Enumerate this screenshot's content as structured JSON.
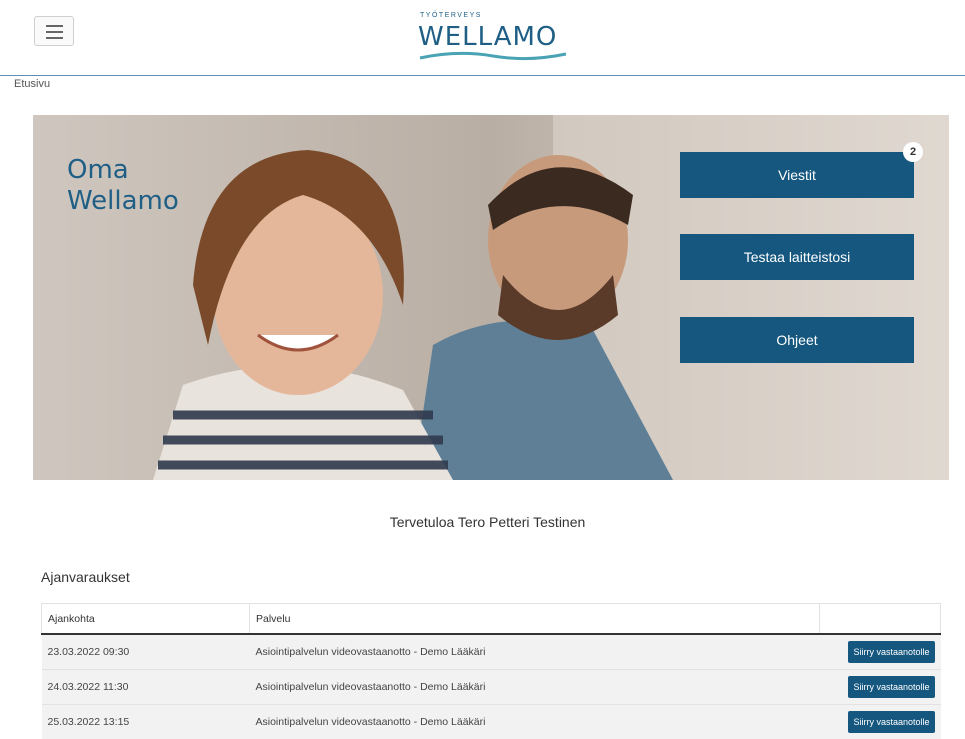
{
  "header": {
    "menu_icon": "hamburger-menu-icon",
    "logo_small": "TYÖTERVEYS",
    "logo_big": "WELLAMO"
  },
  "breadcrumb": "Etusivu",
  "hero": {
    "title_line1": "Oma",
    "title_line2": "Wellamo",
    "buttons": [
      {
        "label": "Viestit",
        "badge": "2"
      },
      {
        "label": "Testaa laitteistosi"
      },
      {
        "label": "Ohjeet"
      }
    ]
  },
  "welcome": "Tervetuloa Tero Petteri Testinen",
  "appointments": {
    "title": "Ajanvaraukset",
    "columns": [
      "Ajankohta",
      "Palvelu",
      ""
    ],
    "rows": [
      {
        "time": "23.03.2022 09:30",
        "service": "Asiointipalvelun videovastaanotto - Demo Lääkäri",
        "action": "Siirry vastaanotolle"
      },
      {
        "time": "24.03.2022 11:30",
        "service": "Asiointipalvelun videovastaanotto - Demo Lääkäri",
        "action": "Siirry vastaanotolle"
      },
      {
        "time": "25.03.2022 13:15",
        "service": "Asiointipalvelun videovastaanotto - Demo Lääkäri",
        "action": "Siirry vastaanotolle"
      }
    ]
  },
  "colors": {
    "primary": "#15577f",
    "brand": "#1f5f86"
  }
}
